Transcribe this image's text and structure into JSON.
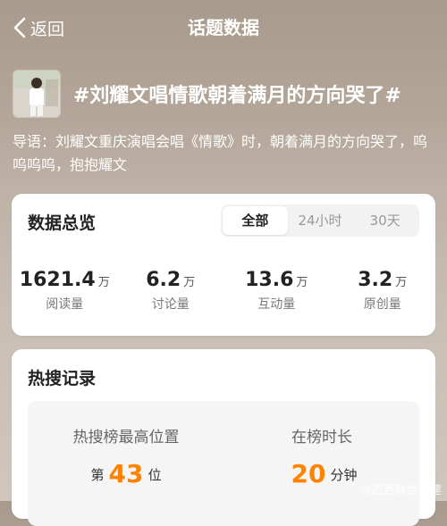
{
  "header": {
    "back_label": "返回",
    "title": "话题数据"
  },
  "topic": {
    "title": "#刘耀文唱情歌朝着满月的方向哭了#",
    "lead": "导语：刘耀文重庆演唱会唱《情歌》时，朝着满月的方向哭了，呜呜呜呜，抱抱耀文"
  },
  "overview": {
    "title": "数据总览",
    "tabs": [
      "全部",
      "24小时",
      "30天"
    ],
    "active_tab": "全部",
    "stats": [
      {
        "value": "1621.4",
        "unit": "万",
        "label": "阅读量"
      },
      {
        "value": "6.2",
        "unit": "万",
        "label": "讨论量"
      },
      {
        "value": "13.6",
        "unit": "万",
        "label": "互动量"
      },
      {
        "value": "3.2",
        "unit": "万",
        "label": "原创量"
      }
    ]
  },
  "hot_search": {
    "title": "热搜记录",
    "peak_label": "热搜榜最高位置",
    "peak_prefix": "第",
    "peak_value": "43",
    "peak_suffix": "位",
    "duration_label": "在榜时长",
    "duration_value": "20",
    "duration_unit": "分钟"
  },
  "colors": {
    "accent": "#ff8200"
  },
  "watermark": "@西西联合子建"
}
